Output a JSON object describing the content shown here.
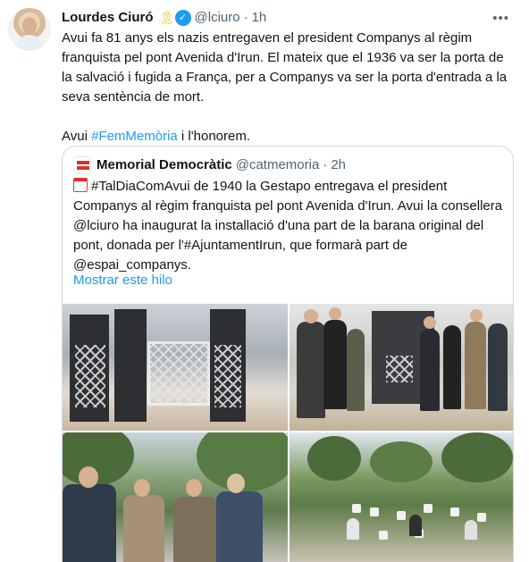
{
  "tweet": {
    "author_name": "Lourdes Ciuró",
    "ribbon_emoji": "🎗",
    "handle": "@lciuro",
    "separator": "·",
    "time": "1h",
    "more_icon": "more-icon",
    "paragraph1": "Avui fa 81 anys els nazis entregaven el president Companys al règim franquista pel pont Avenida d'Irun. El mateix que el 1936 va ser la porta de la salvació i fugida a França, per a Companys va ser la porta d'entrada a la seva sentència de mort.",
    "paragraph2_prefix": "Avui ",
    "paragraph2_hashtag": "#FemMemòria",
    "paragraph2_suffix": " i l'honorem.",
    "accent_color": "#1d9bf0"
  },
  "quoted": {
    "author_name": "Memorial Democràtic",
    "handle": "@catmemoria",
    "separator": "·",
    "time": "2h",
    "text": "#TalDiaComAvui de 1940 la Gestapo entregava el president Companys al règim franquista pel pont Avenida d'Irun. Avui la consellera @lciuro ha inaugurat la installació d'una part de la barana original del pont, donada per l'#AjuntamentIrun, que formarà part de @espai_companys.",
    "show_thread": "Mostrar este hilo"
  }
}
